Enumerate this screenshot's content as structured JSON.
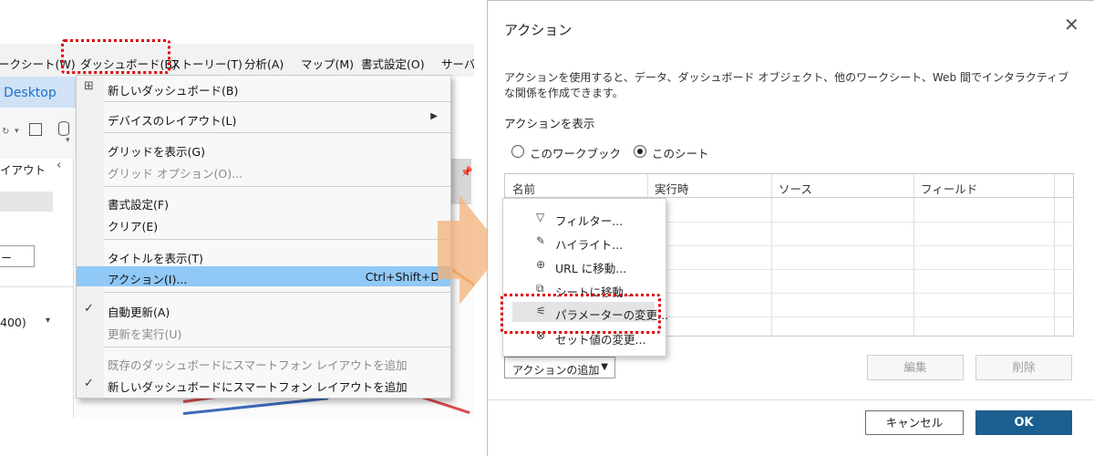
{
  "app": {
    "title": "Desktop",
    "menubar": [
      "ークシート(W)",
      "ダッシュボード(B)",
      "ストーリー(T)",
      "分析(A)",
      "マップ(M)",
      "書式設定(O)",
      "サーバ"
    ],
    "left_panel": {
      "section_label": "イアウト",
      "button_label": "ー",
      "dropdown_value": "400)"
    }
  },
  "dashboard_menu": {
    "items": [
      {
        "label": "新しいダッシュボード(B)"
      },
      {
        "label": "デバイスのレイアウト(L)"
      },
      {
        "label": "グリッドを表示(G)"
      },
      {
        "label": "グリッド オプション(O)..."
      },
      {
        "label": "書式設定(F)"
      },
      {
        "label": "クリア(E)"
      },
      {
        "label": "タイトルを表示(T)"
      },
      {
        "label": "アクション(I)...",
        "shortcut": "Ctrl+Shift+D"
      },
      {
        "label": "自動更新(A)"
      },
      {
        "label": "更新を実行(U)"
      },
      {
        "label": "既存のダッシュボードにスマートフォン レイアウトを追加"
      },
      {
        "label": "新しいダッシュボードにスマートフォン レイアウトを追加"
      }
    ]
  },
  "dialog": {
    "title": "アクション",
    "description": "アクションを使用すると、データ、ダッシュボード オブジェクト、他のワークシート、Web 間でインタラクティブな関係を作成できます。",
    "show_label": "アクションを表示",
    "radio_workbook": "このワークブック",
    "radio_sheet": "このシート",
    "columns": [
      "名前",
      "実行時",
      "ソース",
      "フィールド"
    ],
    "add_action": "アクションの追加",
    "edit": "編集",
    "delete": "削除",
    "cancel": "キャンセル",
    "ok": "OK"
  },
  "action_popup": {
    "items": [
      {
        "label": "フィルター...",
        "icon": "filter-icon"
      },
      {
        "label": "ハイライト...",
        "icon": "highlight-icon"
      },
      {
        "label": "URL に移動...",
        "icon": "globe-icon"
      },
      {
        "label": "シートに移動...",
        "icon": "goto-sheet-icon"
      },
      {
        "label": "パラメーターの変更...",
        "icon": "parameter-icon"
      },
      {
        "label": "セット値の変更...",
        "icon": "set-icon"
      }
    ]
  },
  "colors": {
    "highlight": "#90c8f6",
    "ok_button": "#1b5f8e",
    "annotation": "#e00000",
    "arrow": "#f3b07a"
  }
}
